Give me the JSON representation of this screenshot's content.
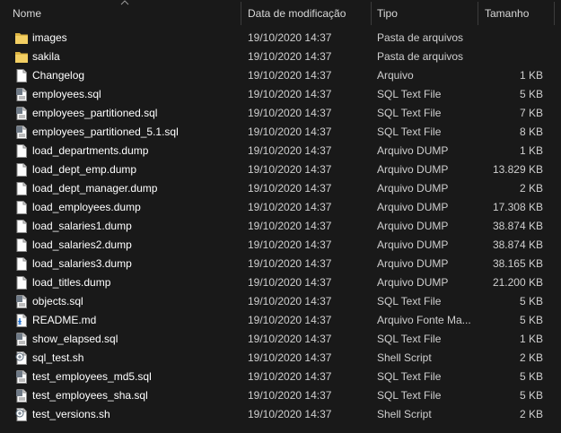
{
  "columns": {
    "name": "Nome",
    "date": "Data de modificação",
    "type": "Tipo",
    "size": "Tamanho"
  },
  "files": [
    {
      "name": "images",
      "date": "19/10/2020 14:37",
      "type": "Pasta de arquivos",
      "size": "",
      "icon": "folder-icon"
    },
    {
      "name": "sakila",
      "date": "19/10/2020 14:37",
      "type": "Pasta de arquivos",
      "size": "",
      "icon": "folder-icon"
    },
    {
      "name": "Changelog",
      "date": "19/10/2020 14:37",
      "type": "Arquivo",
      "size": "1 KB",
      "icon": "file-icon"
    },
    {
      "name": "employees.sql",
      "date": "19/10/2020 14:37",
      "type": "SQL Text File",
      "size": "5 KB",
      "icon": "sql-file-icon"
    },
    {
      "name": "employees_partitioned.sql",
      "date": "19/10/2020 14:37",
      "type": "SQL Text File",
      "size": "7 KB",
      "icon": "sql-file-icon"
    },
    {
      "name": "employees_partitioned_5.1.sql",
      "date": "19/10/2020 14:37",
      "type": "SQL Text File",
      "size": "8 KB",
      "icon": "sql-file-icon"
    },
    {
      "name": "load_departments.dump",
      "date": "19/10/2020 14:37",
      "type": "Arquivo DUMP",
      "size": "1 KB",
      "icon": "file-icon"
    },
    {
      "name": "load_dept_emp.dump",
      "date": "19/10/2020 14:37",
      "type": "Arquivo DUMP",
      "size": "13.829 KB",
      "icon": "file-icon"
    },
    {
      "name": "load_dept_manager.dump",
      "date": "19/10/2020 14:37",
      "type": "Arquivo DUMP",
      "size": "2 KB",
      "icon": "file-icon"
    },
    {
      "name": "load_employees.dump",
      "date": "19/10/2020 14:37",
      "type": "Arquivo DUMP",
      "size": "17.308 KB",
      "icon": "file-icon"
    },
    {
      "name": "load_salaries1.dump",
      "date": "19/10/2020 14:37",
      "type": "Arquivo DUMP",
      "size": "38.874 KB",
      "icon": "file-icon"
    },
    {
      "name": "load_salaries2.dump",
      "date": "19/10/2020 14:37",
      "type": "Arquivo DUMP",
      "size": "38.874 KB",
      "icon": "file-icon"
    },
    {
      "name": "load_salaries3.dump",
      "date": "19/10/2020 14:37",
      "type": "Arquivo DUMP",
      "size": "38.165 KB",
      "icon": "file-icon"
    },
    {
      "name": "load_titles.dump",
      "date": "19/10/2020 14:37",
      "type": "Arquivo DUMP",
      "size": "21.200 KB",
      "icon": "file-icon"
    },
    {
      "name": "objects.sql",
      "date": "19/10/2020 14:37",
      "type": "SQL Text File",
      "size": "5 KB",
      "icon": "sql-file-icon"
    },
    {
      "name": "README.md",
      "date": "19/10/2020 14:37",
      "type": "Arquivo Fonte Ma...",
      "size": "5 KB",
      "icon": "markdown-file-icon"
    },
    {
      "name": "show_elapsed.sql",
      "date": "19/10/2020 14:37",
      "type": "SQL Text File",
      "size": "1 KB",
      "icon": "sql-file-icon"
    },
    {
      "name": "sql_test.sh",
      "date": "19/10/2020 14:37",
      "type": "Shell Script",
      "size": "2 KB",
      "icon": "shell-script-icon"
    },
    {
      "name": "test_employees_md5.sql",
      "date": "19/10/2020 14:37",
      "type": "SQL Text File",
      "size": "5 KB",
      "icon": "sql-file-icon"
    },
    {
      "name": "test_employees_sha.sql",
      "date": "19/10/2020 14:37",
      "type": "SQL Text File",
      "size": "5 KB",
      "icon": "sql-file-icon"
    },
    {
      "name": "test_versions.sh",
      "date": "19/10/2020 14:37",
      "type": "Shell Script",
      "size": "2 KB",
      "icon": "shell-script-icon"
    }
  ]
}
